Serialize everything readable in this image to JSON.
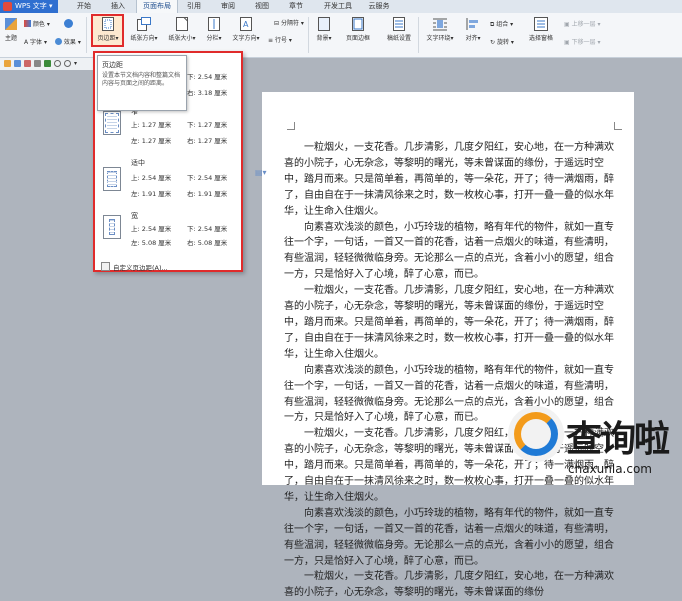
{
  "app": {
    "name": "WPS 文字"
  },
  "tabs": [
    "开始",
    "插入",
    "页面布局",
    "引用",
    "审阅",
    "视图",
    "章节",
    "开发工具",
    "云服务"
  ],
  "ribbon": {
    "theme": "主题",
    "colors": "颜色",
    "fonts": "字体",
    "effects": "效果",
    "margins": "页边距",
    "orientation": "纸张方向",
    "size": "纸张大小",
    "columns": "分栏",
    "text_direction": "文字方向",
    "line_numbers": "行号",
    "breaks": "分隔符",
    "background": "背景",
    "page_border": "页面边框",
    "draft": "稿纸设置",
    "wrap": "文字环绕",
    "align": "对齐",
    "rotate": "旋转",
    "combine": "组合",
    "select_pane": "选择窗格",
    "bring_forward": "上移一层",
    "send_backward": "下移一层"
  },
  "tooltip": {
    "title": "页边距",
    "desc": "设置本节文档内容和整篇文档内容与页面之间的距离。"
  },
  "margin_options": [
    {
      "name": "",
      "top": "下: 2.54 厘米",
      "left": "",
      "right": "右: 3.18 厘米"
    },
    {
      "name": "窄",
      "top": "上: 1.27 厘米",
      "bottom": "下: 1.27 厘米",
      "left": "左: 1.27 厘米",
      "right": "右: 1.27 厘米"
    },
    {
      "name": "适中",
      "top": "上: 2.54 厘米",
      "bottom": "下: 2.54 厘米",
      "left": "左: 1.91 厘米",
      "right": "右: 1.91 厘米"
    },
    {
      "name": "宽",
      "top": "上: 2.54 厘米",
      "bottom": "下: 2.54 厘米",
      "left": "左: 5.08 厘米",
      "right": "右: 5.08 厘米"
    }
  ],
  "custom_margins": "自定义页边距(A)...",
  "document": {
    "paragraphs": [
      "一粒烟火，一支花香。几步清影，几度夕阳红，安心地，在一方种满欢喜的小院子，心无杂念，等黎明的曙光，等未曾谋面的缘份，于遥远时空中，踏月而来。只是简单着，再简单的，等一朵花，开了；待一满烟雨，醉了，自由自在于一抹清风徐来之时，数一枚枚心事，打开一叠一叠的似水年华，让生命入住烟火。",
      "向素喜欢浅淡的颜色，小巧玲珑的植物，略有年代的物件，就如一直专往一个字，一句话，一首又一首的花香，诂着一点烟火的味道，有些清明，有些温润，轻轻微微临身旁。无论那么一点的点光，含着小小的愿望，组合一方，只是恰好入了心境，醉了心意，而已。",
      "一粒烟火，一支花香。几步清影，几度夕阳红，安心地，在一方种满欢喜的小院子，心无杂念，等黎明的曙光，等未曾谋面的缘份，于遥远时空中，踏月而来。只是简单着，再简单的，等一朵花，开了；待一满烟雨，醉了，自由自在于一抹清风徐来之时，数一枚枚心事，打开一叠一叠的似水年华，让生命入住烟火。",
      "向素喜欢浅淡的颜色，小巧玲珑的植物，略有年代的物件，就如一直专往一个字，一句话，一首又一首的花香，诂着一点烟火的味道，有些清明，有些温润，轻轻微微临身旁。无论那么一点的点光，含着小小的愿望，组合一方，只是恰好入了心境，醉了心意，而已。",
      "一粒烟火，一支花香。几步清影，几度夕阳红，安心地，在一方种满欢喜的小院子，心无杂念，等黎明的曙光，等未曾谋面的缘份，于遥远时空中，踏月而来。只是简单着，再简单的，等一朵花，开了；待一满烟雨，醉了，自由自在于一抹清风徐来之时，数一枚枚心事，打开一叠一叠的似水年华，让生命入住烟火。",
      "向素喜欢浅淡的颜色，小巧玲珑的植物，略有年代的物件，就如一直专往一个字，一句话，一首又一首的花香，诂着一点烟火的味道，有些清明，有些温润，轻轻微微临身旁。无论那么一点的点光，含着小小的愿望，组合一方，只是恰好入了心境，醉了心意，而已。",
      "一粒烟火，一支花香。几步清影，几度夕阳红，安心地，在一方种满欢喜的小院子，心无杂念，等黎明的曙光，等未曾谋面的缘份"
    ]
  },
  "watermark": {
    "cn": "查询啦",
    "en": "chaxunla.com"
  },
  "colors": {
    "accent": "#e02b2b",
    "wps_blue": "#2f6fd0",
    "brand_orange": "#f39b1b",
    "brand_blue": "#1f7ad6"
  }
}
